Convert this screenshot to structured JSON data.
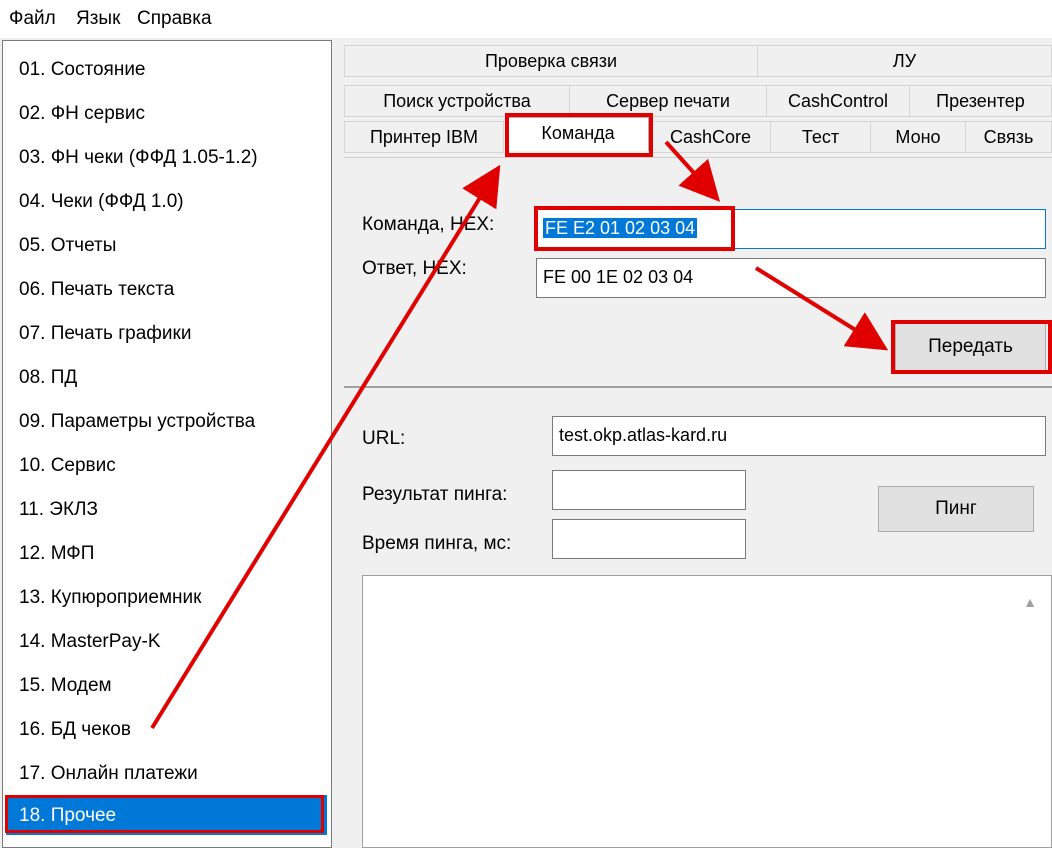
{
  "menu": [
    "Файл",
    "Язык",
    "Справка"
  ],
  "nav": {
    "items": [
      "01. Состояние",
      "02. ФН сервис",
      "03. ФН чеки (ФФД 1.05-1.2)",
      "04. Чеки (ФФД 1.0)",
      "05. Отчеты",
      "06. Печать текста",
      "07. Печать графики",
      "08. ПД",
      "09. Параметры устройства",
      "10. Сервис",
      "11. ЭКЛЗ",
      "12. МФП",
      "13. Купюроприемник",
      "14. MasterPay-K",
      "15. Модем",
      "16. БД чеков",
      "17. Онлайн платежи",
      "18. Прочее"
    ],
    "selected_index": 17
  },
  "tabs": {
    "row1": [
      "Проверка связи",
      "ЛУ"
    ],
    "row2": [
      "Поиск устройства",
      "Сервер печати",
      "CashControl",
      "Презентер"
    ],
    "row3": [
      "Принтер IBM",
      "Команда",
      "CashCore",
      "Тест",
      "Моно",
      "Связь"
    ],
    "active": "Команда"
  },
  "command": {
    "cmd_label": "Команда, HEX:",
    "cmd_value": "FE E2 01 02 03 04",
    "resp_label": "Ответ, HEX:",
    "resp_value": "FE 00 1E 02 03 04",
    "send_button": "Передать"
  },
  "ping": {
    "url_label": "URL:",
    "url_value": "test.okp.atlas-kard.ru",
    "result_label": "Результат пинга:",
    "result_value": "",
    "time_label": "Время пинга, мс:",
    "time_value": "",
    "ping_button": "Пинг"
  },
  "colors": {
    "highlight": "#e00000",
    "selection": "#0078d7"
  }
}
